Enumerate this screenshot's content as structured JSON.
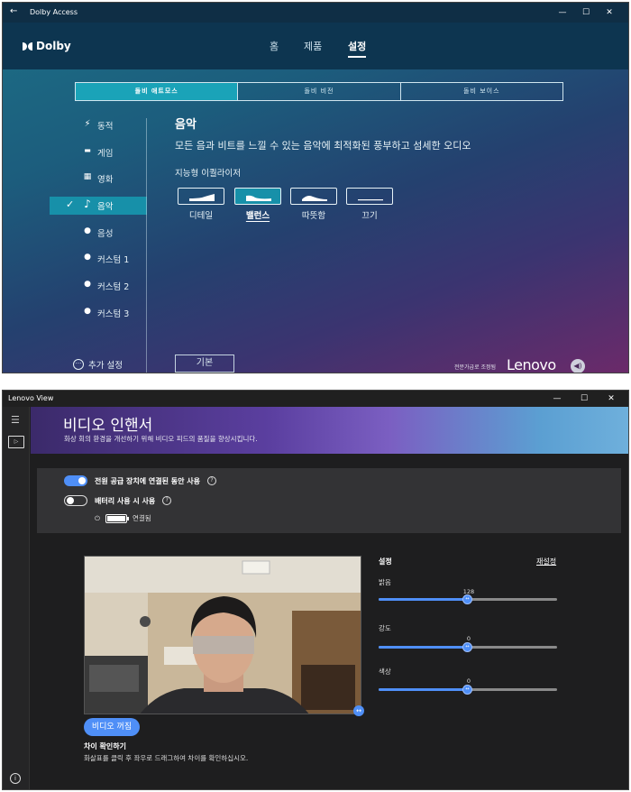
{
  "dolby": {
    "window_title": "Dolby Access",
    "back_glyph": "←",
    "controls": [
      "—",
      "☐",
      "✕"
    ],
    "logo": "Dolby",
    "nav": [
      {
        "label": "홈",
        "active": false
      },
      {
        "label": "제품",
        "active": false
      },
      {
        "label": "설정",
        "active": true
      }
    ],
    "tabs": [
      {
        "label": "돌비 애트모스",
        "active": true
      },
      {
        "label": "돌비 비전",
        "active": false
      },
      {
        "label": "돌비 보이스",
        "active": false
      }
    ],
    "sidebar": [
      {
        "label": "동적",
        "icon": "lightning-icon",
        "glyph": "⚡"
      },
      {
        "label": "게임",
        "icon": "gamepad-icon",
        "glyph": "🎮"
      },
      {
        "label": "영화",
        "icon": "film-icon",
        "glyph": "🎬"
      },
      {
        "label": "음악",
        "icon": "music-note-icon",
        "glyph": "♪",
        "active": true
      },
      {
        "label": "음성",
        "icon": "voice-icon",
        "glyph": "●"
      },
      {
        "label": "커스텀 1",
        "icon": "user-icon",
        "glyph": "●"
      },
      {
        "label": "커스텀 2",
        "icon": "user-icon",
        "glyph": "●"
      },
      {
        "label": "커스텀 3",
        "icon": "user-icon",
        "glyph": "●"
      }
    ],
    "more_settings": "추가 설정",
    "content": {
      "title": "음악",
      "description": "모든 음과 비트를 느낄 수 있는 음악에 최적화된 풍부하고 섬세한 오디오",
      "equalizer_label": "지능형 이퀄라이저",
      "presets": [
        {
          "label": "디테일",
          "active": false
        },
        {
          "label": "밸런스",
          "active": true
        },
        {
          "label": "따뜻함",
          "active": false
        },
        {
          "label": "끄기",
          "active": false
        }
      ],
      "default_button": "기본"
    },
    "tuned_by": "전문가급로 조정됨",
    "brand": "Lenovo",
    "speaker_glyph": "◀)"
  },
  "lenovo_view": {
    "window_title": "Lenovo View",
    "controls": [
      "—",
      "☐",
      "✕"
    ],
    "banner": {
      "title": "비디오 인핸서",
      "subtitle": "화상 회의 환경을 개선하기 위해 비디오 피드의 품질을 향상시킵니다."
    },
    "toggles": [
      {
        "label": "전원 공급 장치에 연결된 동안 사용",
        "on": true
      },
      {
        "label": "배터리 사용 시 사용",
        "on": false
      }
    ],
    "power_status": "연결됨",
    "video_off_button": "비디오 꺼짐",
    "diff_title": "차이 확인하기",
    "diff_desc": "화살표를 클릭 후 좌우로 드래그하여 차이를 확인하십시오.",
    "settings": {
      "title": "설정",
      "reset": "재설정",
      "sliders": [
        {
          "label": "밝음",
          "value": "128",
          "fraction": 0.5
        },
        {
          "label": "강도",
          "value": "0",
          "fraction": 0.5
        },
        {
          "label": "색상",
          "value": "0",
          "fraction": 0.5
        }
      ]
    }
  }
}
